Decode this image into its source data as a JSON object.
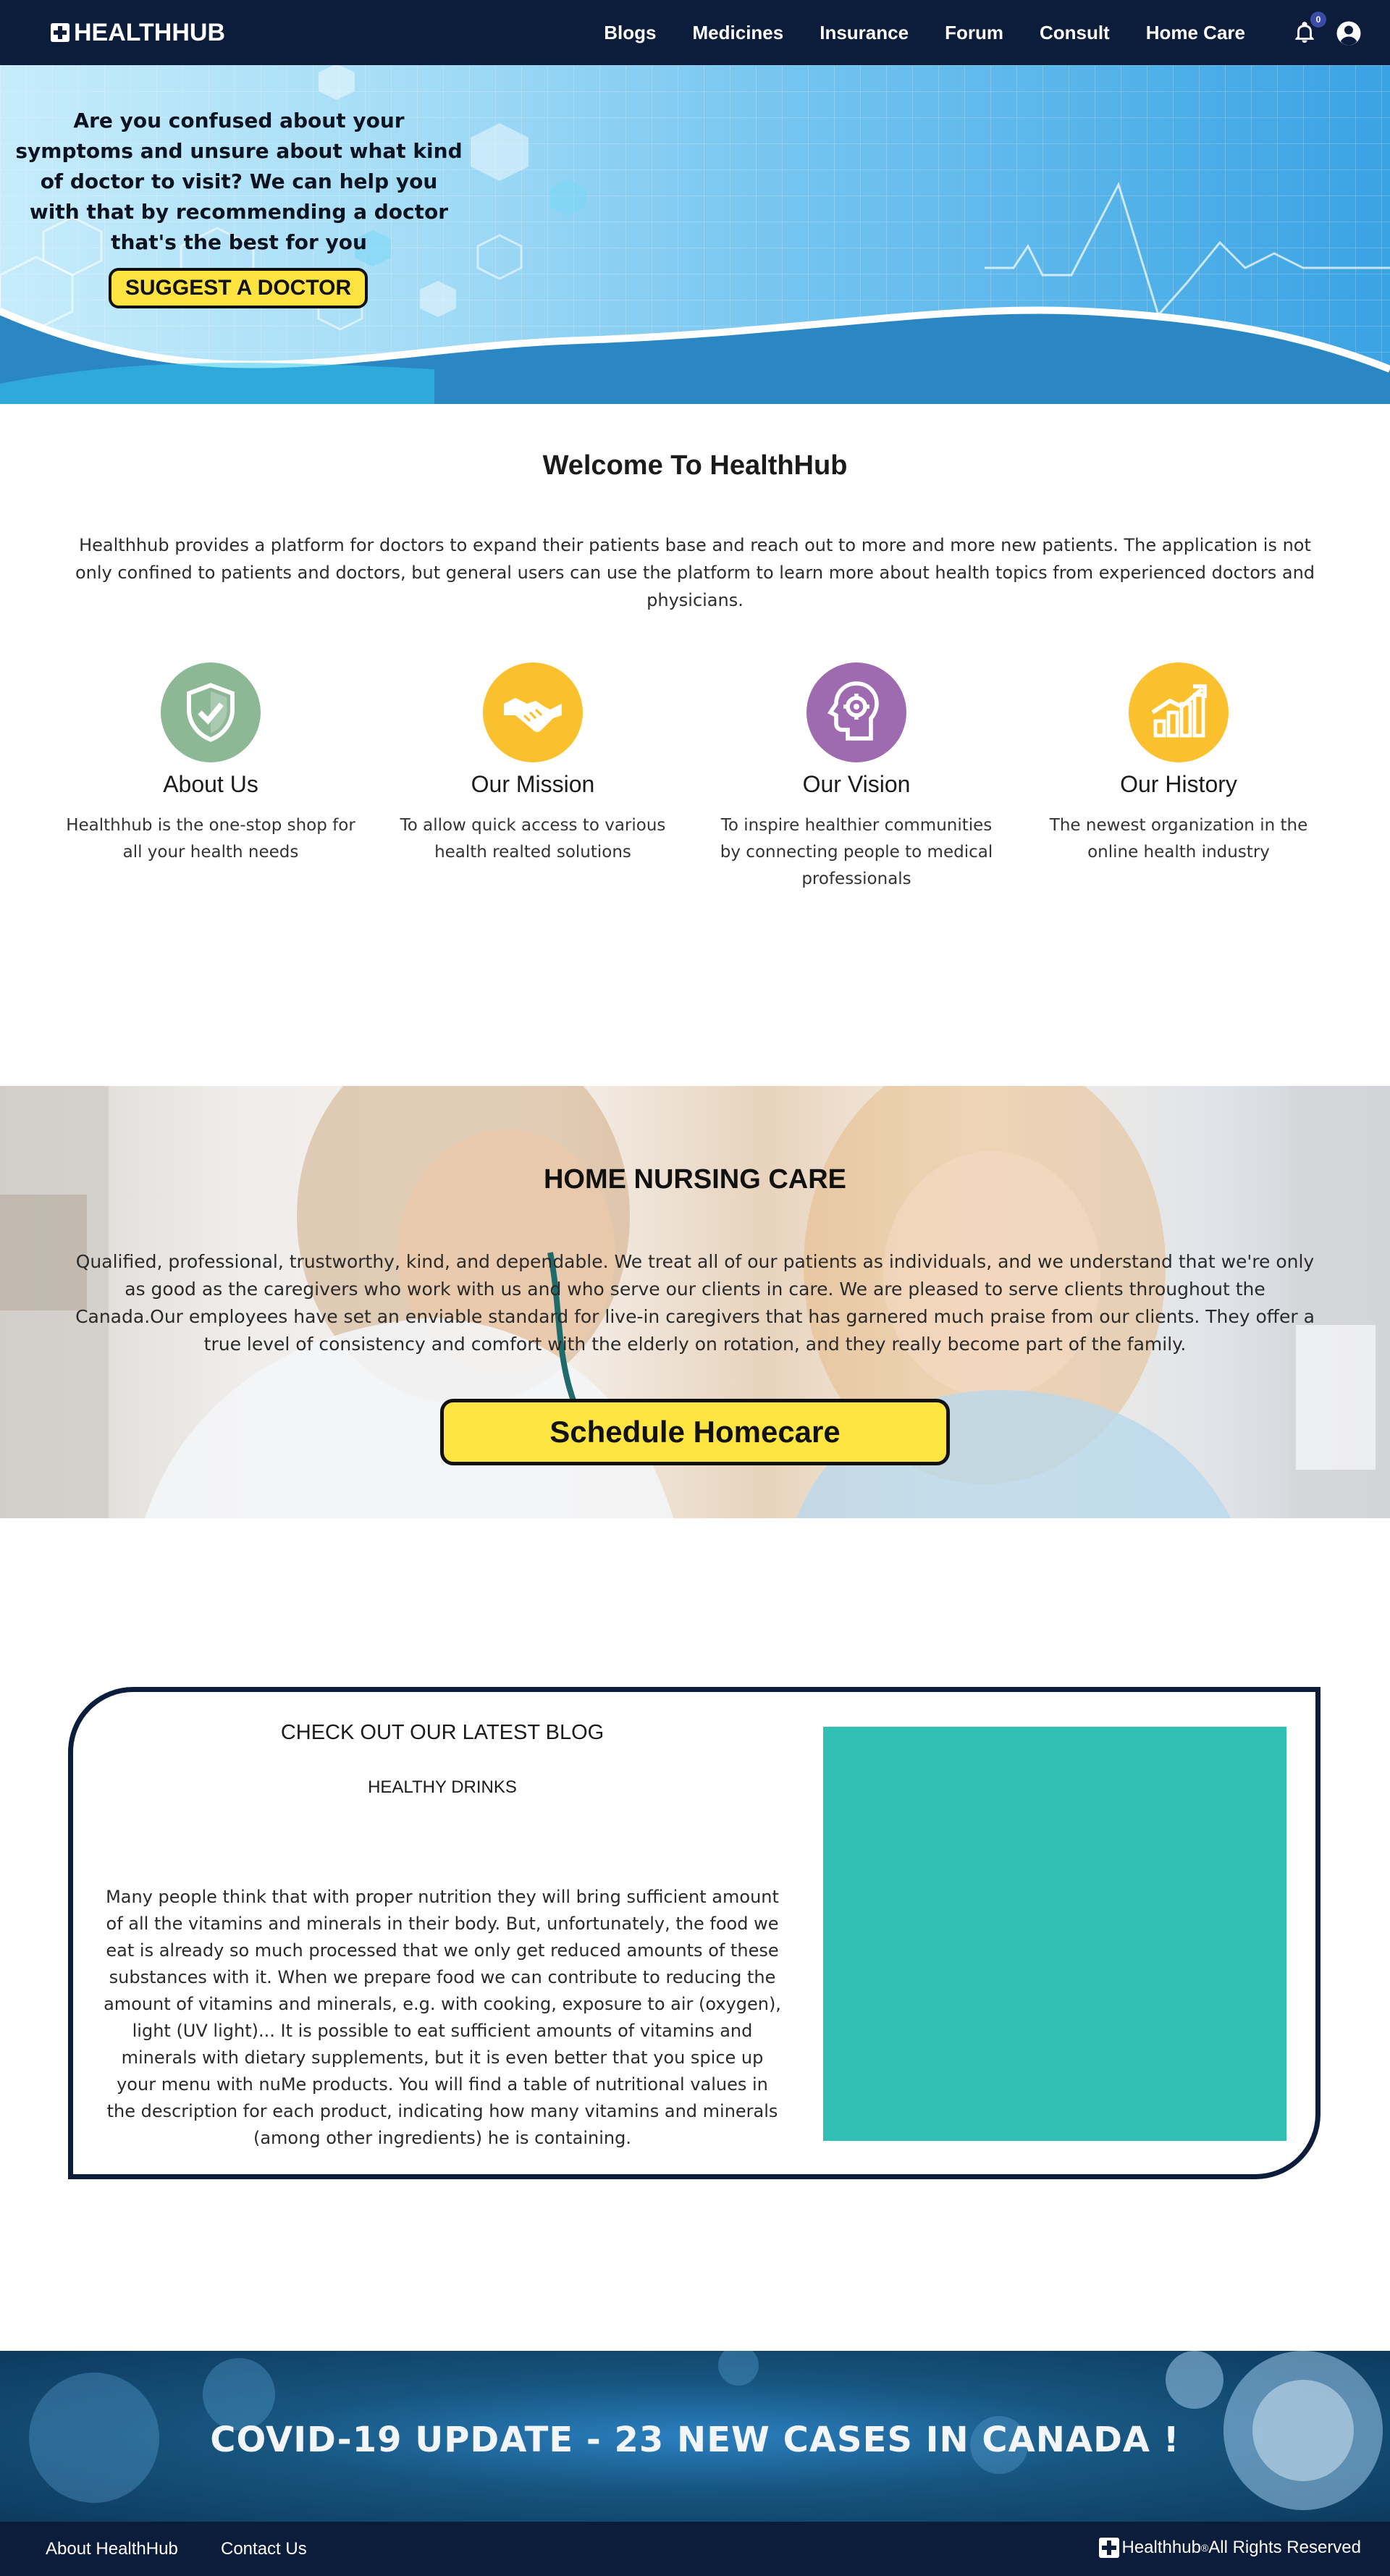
{
  "navbar": {
    "brand": "HEALTHHUB",
    "links": [
      "Blogs",
      "Medicines",
      "Insurance",
      "Forum",
      "Consult",
      "Home Care"
    ],
    "notification_count": "0"
  },
  "hero": {
    "text": "Are you confused about your symptoms and unsure about what kind of doctor to visit? We can help you with that by recommending a doctor that's the best for you",
    "button": "SUGGEST A DOCTOR"
  },
  "welcome": {
    "title": "Welcome To HealthHub",
    "text": "Healthhub provides a platform for doctors to expand their patients base and reach out to more and more new patients. The application is not only confined to patients and doctors, but general users can use the platform to learn more about health topics from experienced doctors and physicians."
  },
  "features": [
    {
      "icon": "shield-check-icon",
      "color": "#8db896",
      "title": "About Us",
      "text": "Healthhub is the one-stop shop for all your health needs"
    },
    {
      "icon": "handshake-icon",
      "color": "#fbc02d",
      "title": "Our Mission",
      "text": "To allow quick access to various health realted solutions"
    },
    {
      "icon": "head-gear-icon",
      "color": "#9e6bb0",
      "title": "Our Vision",
      "text": "To inspire healthier communities by connecting people to medical professionals"
    },
    {
      "icon": "growth-chart-icon",
      "color": "#fbc02d",
      "title": "Our History",
      "text": "The newest organization in the online health industry"
    }
  ],
  "nursing": {
    "title": "HOME NURSING CARE",
    "text": "Qualified, professional, trustworthy, kind, and dependable. We treat all of our patients as individuals, and we understand that we're only as good as the caregivers who work with us and who serve our clients in care. We are pleased to serve clients throughout the Canada.Our employees have set an enviable standard for live-in caregivers that has garnered much praise from our clients. They offer a true level of consistency and comfort with the elderly on rotation, and they really become part of the family.",
    "button": "Schedule Homecare"
  },
  "blog": {
    "heading": "CHECK OUT OUR LATEST BLOG",
    "title": "HEALTHY DRINKS",
    "text": "Many people think that with proper nutrition they will bring sufficient amount of all the vitamins and minerals in their body. But, unfortunately, the food we eat is already so much processed that we only get reduced amounts of these substances with it. When we prepare food we can contribute to reducing the amount of vitamins and minerals, e.g. with cooking, exposure to air (oxygen), light (UV light)... It is possible to eat sufficient amounts of vitamins and minerals with dietary supplements, but it is even better that you spice up your menu with nuMe products. You will find a table of nutritional values in the description for each product, indicating how many vitamins and minerals (among other ingredients) he is containing.",
    "image_color": "#31beb3"
  },
  "covid": {
    "text": "COVID-19 UPDATE -   23 NEW CASES IN CANADA !"
  },
  "footer": {
    "links": [
      "About HealthHub",
      "Contact Us"
    ],
    "brand": "Healthhub",
    "reg": "®",
    "rights": " All Rights Reserved"
  },
  "colors": {
    "navy": "#0c1d3b",
    "accent_yellow": "#ffe341",
    "teal": "#31beb3"
  }
}
